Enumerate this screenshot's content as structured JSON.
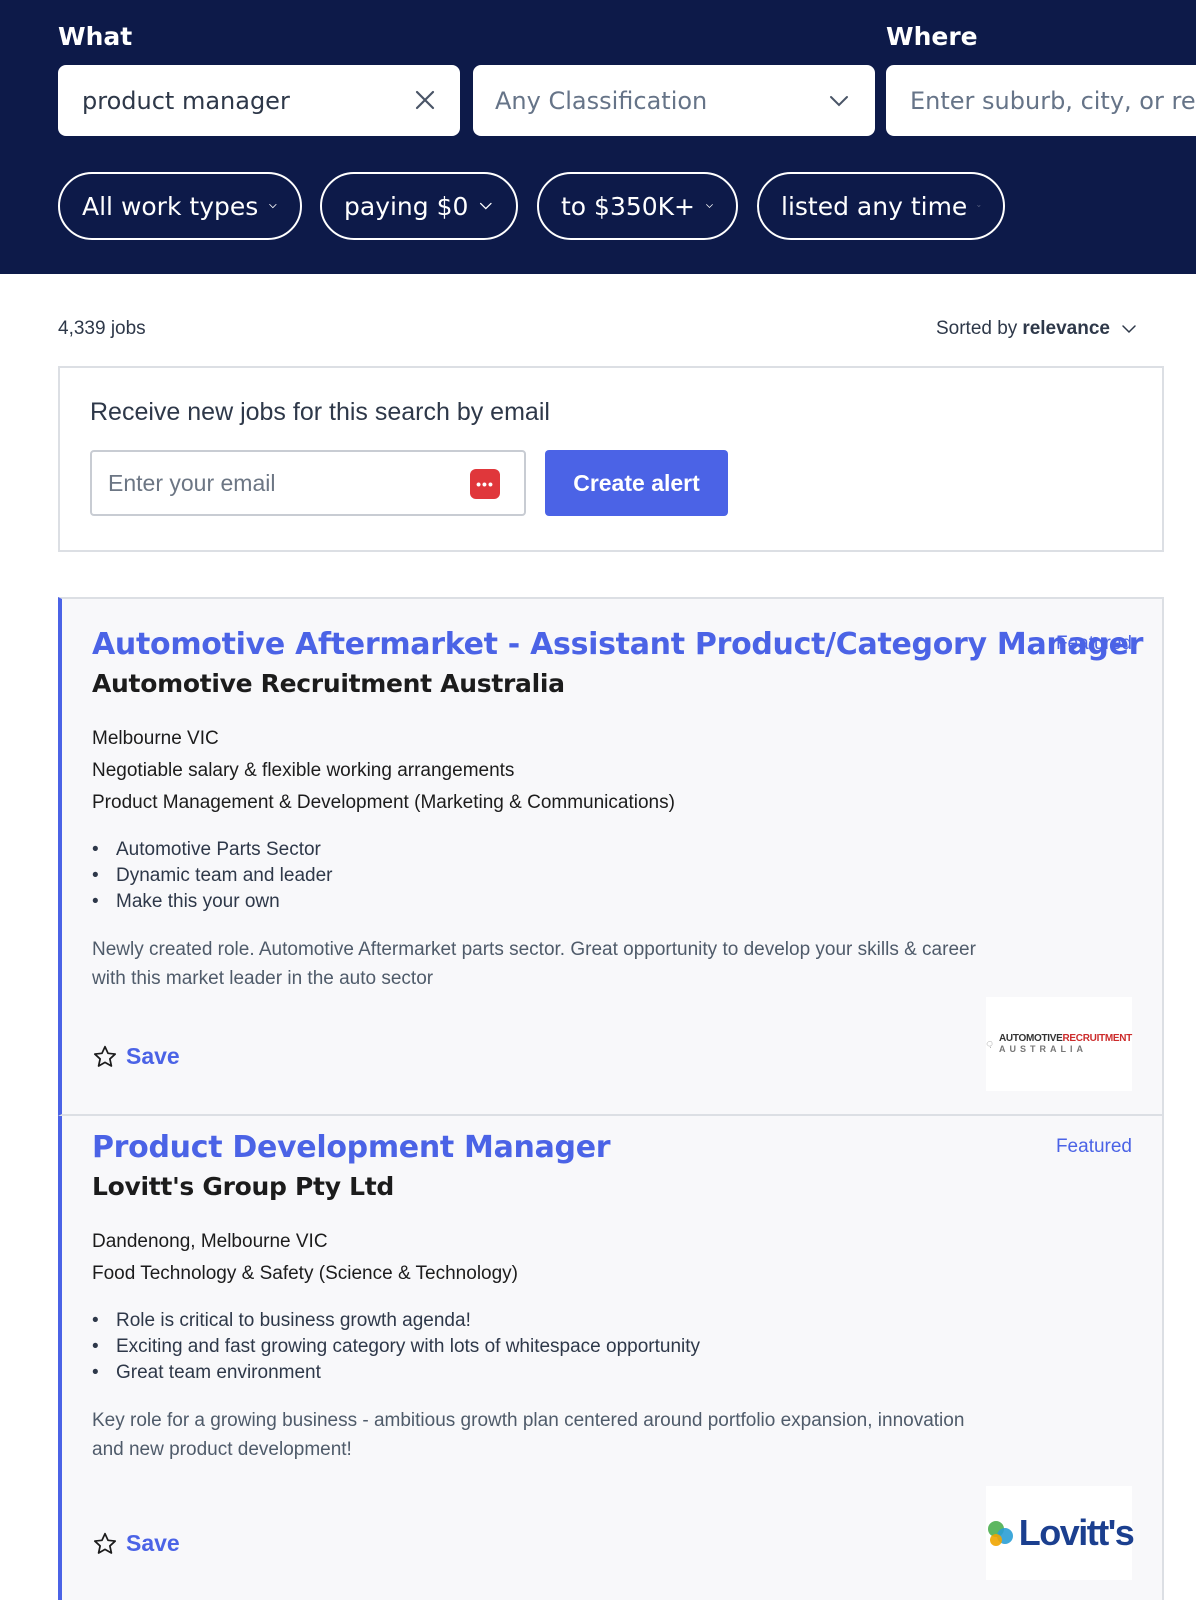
{
  "search": {
    "what_label": "What",
    "where_label": "Where",
    "keywords_value": "product manager",
    "classification_value": "Any Classification",
    "where_placeholder": "Enter suburb, city, or reg"
  },
  "filters": [
    {
      "label": "All work types"
    },
    {
      "label": "paying $0"
    },
    {
      "label": "to $350K+"
    },
    {
      "label": "listed any time"
    }
  ],
  "results": {
    "count_text": "4,339 jobs",
    "sort_prefix": "Sorted by",
    "sort_value": "relevance"
  },
  "alert": {
    "title": "Receive new jobs for this search by email",
    "email_placeholder": "Enter your email",
    "button_label": "Create alert"
  },
  "jobs": [
    {
      "title": "Automotive Aftermarket - Assistant Product/Category Manager",
      "company": "Automotive Recruitment Australia",
      "badge": "Featured",
      "location": "Melbourne VIC",
      "salary": "Negotiable salary & flexible working arrangements",
      "classification": "Product Management & Development (Marketing & Communications)",
      "bullets": [
        "Automotive Parts Sector",
        "Dynamic team and leader",
        "Make this your own"
      ],
      "description": "Newly created role. Automotive Aftermarket parts sector. Great opportunity to develop your skills & career with this market leader in the auto sector",
      "save_label": "Save",
      "logo_text": "AUTOMOTIVE RECRUITMENT AUSTRALIA"
    },
    {
      "title": "Product Development Manager",
      "company": "Lovitt's Group Pty Ltd",
      "badge": "Featured",
      "location": "Dandenong, Melbourne VIC",
      "classification": "Food Technology & Safety (Science & Technology)",
      "bullets": [
        "Role is critical to business growth agenda!",
        "Exciting and fast growing category with lots of whitespace opportunity",
        "Great team environment"
      ],
      "description": "Key role for a growing business - ambitious growth plan centered around portfolio expansion, innovation and new product development!",
      "save_label": "Save",
      "logo_text": "Lovitt's"
    }
  ],
  "colors": {
    "banner": "#0d1a49",
    "accent": "#4b63e6",
    "card_bg": "#f8f8fa"
  }
}
